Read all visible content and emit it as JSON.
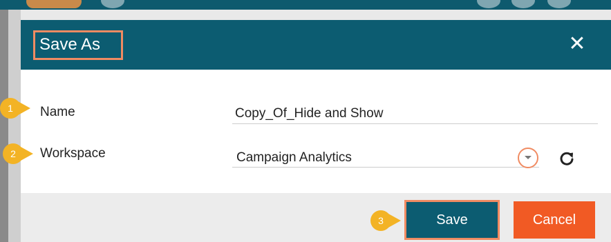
{
  "dialog": {
    "title": "Save As",
    "close_symbol": "✕"
  },
  "markers": [
    "1",
    "2",
    "3"
  ],
  "fields": {
    "name": {
      "label": "Name",
      "value": "Copy_Of_Hide and Show"
    },
    "workspace": {
      "label": "Workspace",
      "value": "Campaign Analytics"
    }
  },
  "footer": {
    "save_label": "Save",
    "cancel_label": "Cancel"
  },
  "colors": {
    "header": "#0c5c71",
    "highlight": "#f08b62",
    "marker": "#f3b325",
    "cancel": "#f15a24"
  },
  "icons": {
    "close": "close-icon",
    "dropdown": "chevron-down-icon",
    "refresh": "refresh-icon"
  }
}
